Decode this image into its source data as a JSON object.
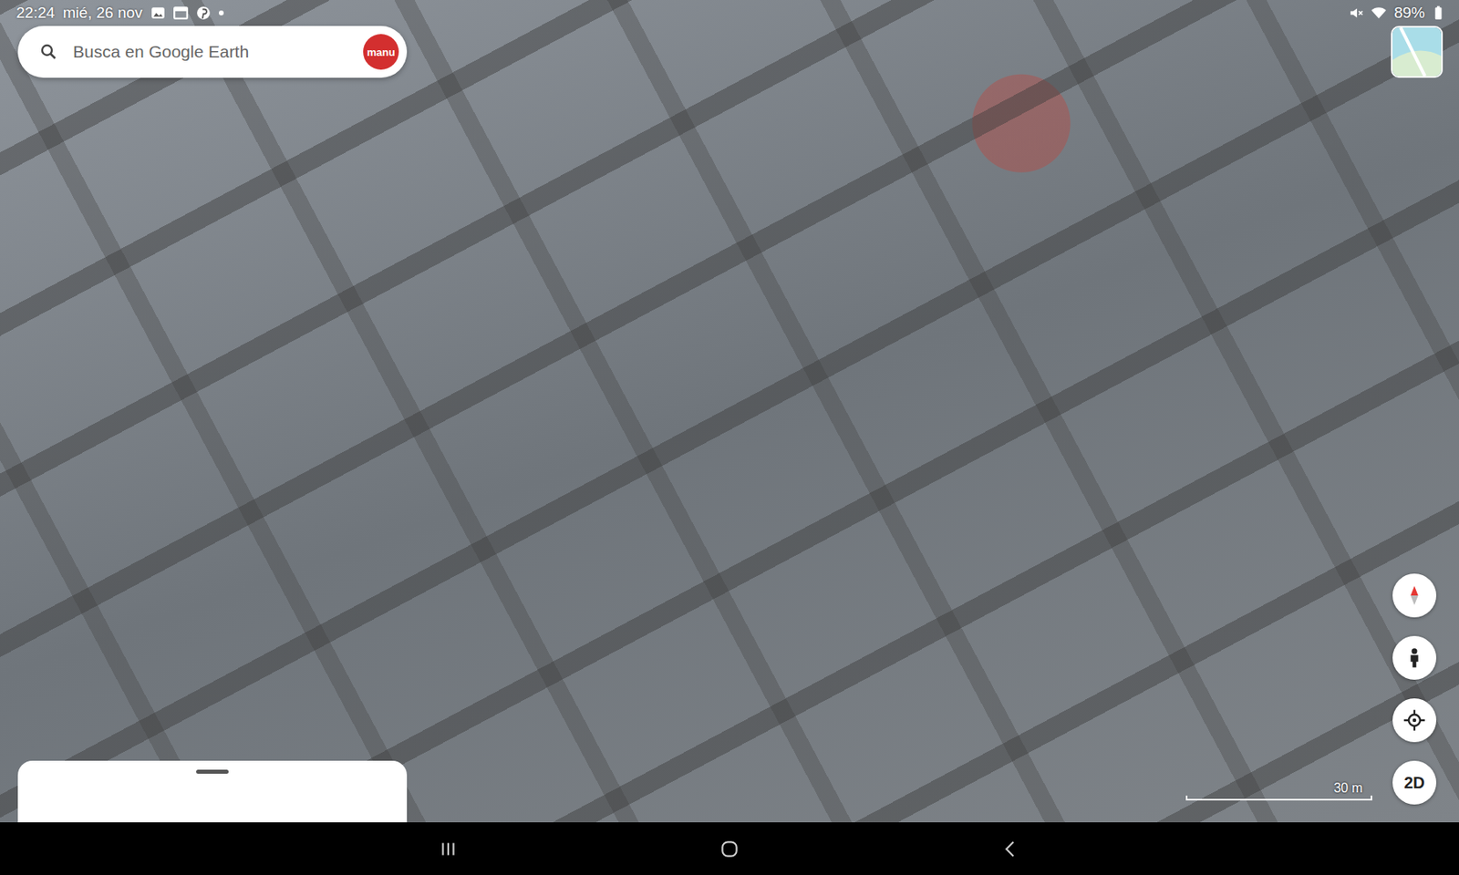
{
  "status_bar": {
    "time": "22:24",
    "date": "mié, 26 nov",
    "battery": "89%"
  },
  "search": {
    "placeholder": "Busca en Google Earth",
    "avatar": "manu"
  },
  "map": {
    "view_mode_button": "2D",
    "scale": "30 m"
  }
}
